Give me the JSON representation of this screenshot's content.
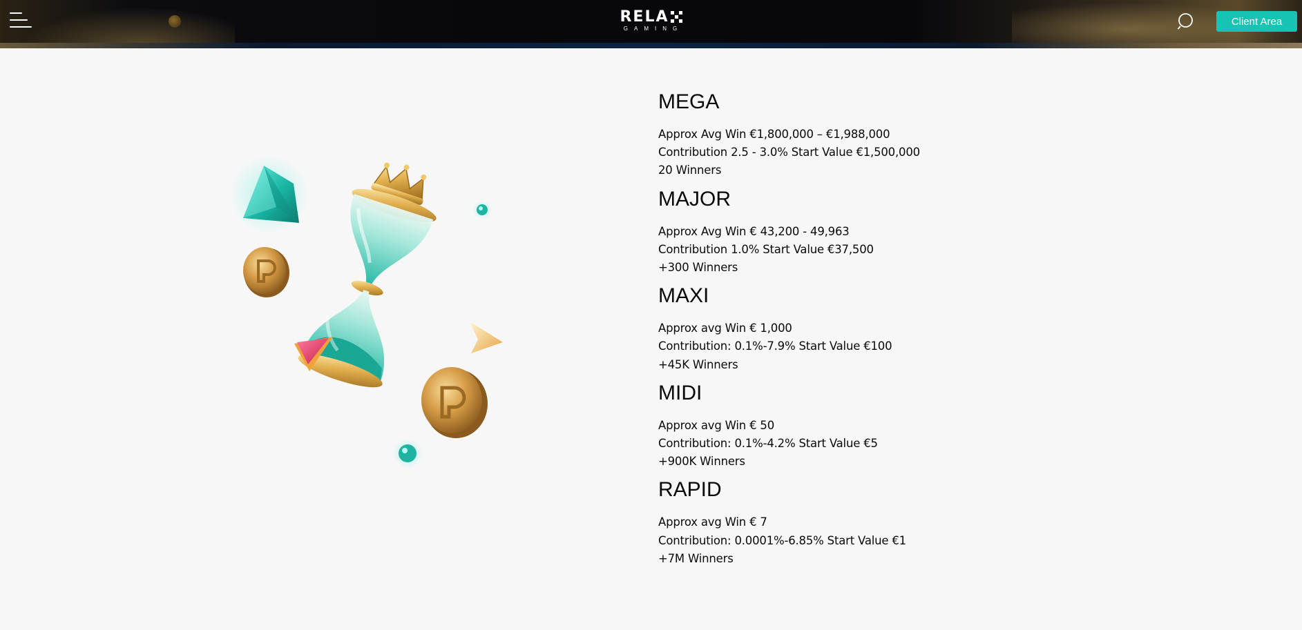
{
  "header": {
    "logo_main": "RELA",
    "logo_sub": "GAMING",
    "client_area_label": "Client Area"
  },
  "icons": {
    "menu": "hamburger-menu-icon",
    "search": "search-icon"
  },
  "colors": {
    "accent": "#17c3b2",
    "header_bg": "#08080c",
    "page_bg": "#f7f7f7"
  },
  "jackpots": [
    {
      "name": "MEGA",
      "line1": "Approx Avg Win €1,800,000 – €1,988,000",
      "line2": "Contribution 2.5 - 3.0% Start Value €1,500,000",
      "line3": "20 Winners"
    },
    {
      "name": "MAJOR",
      "line1": "Approx Avg Win € 43,200 - 49,963",
      "line2": "Contribution 1.0% Start Value €37,500",
      "line3": "+300 Winners"
    },
    {
      "name": "MAXI",
      "line1": "Approx avg Win € 1,000",
      "line2": "Contribution: 0.1%-7.9% Start Value €100",
      "line3": "+45K Winners"
    },
    {
      "name": "MIDI",
      "line1": "Approx avg Win € 50",
      "line2": "Contribution: 0.1%-4.2% Start Value €5",
      "line3": "+900K Winners"
    },
    {
      "name": "RAPID",
      "line1": "Approx avg Win € 7",
      "line2": "Contribution: 0.0001%-6.85% Start Value €1",
      "line3": "+7M Winners"
    }
  ]
}
